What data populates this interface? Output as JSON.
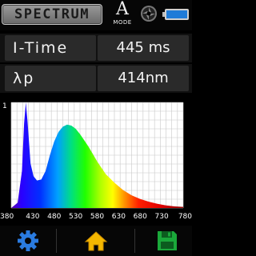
{
  "header": {
    "title": "SPECTRUM",
    "mode_letter": "A",
    "mode_label": "MODE",
    "icons": [
      "shutter-icon",
      "battery-icon"
    ]
  },
  "readings": {
    "itime_label": "I-Time",
    "itime_value": "445 ms",
    "peak_label": "λp",
    "peak_value": "414nm"
  },
  "chart_data": {
    "type": "area",
    "title": "",
    "xlabel": "",
    "ylabel": "",
    "y_tick_label": "1",
    "xlim": [
      380,
      780
    ],
    "ylim": [
      0,
      1
    ],
    "x_tick_labels": [
      "380",
      "430",
      "480",
      "530",
      "580",
      "630",
      "680",
      "730",
      "780"
    ],
    "grid": true,
    "fill": "visible-spectrum gradient",
    "series": [
      {
        "x": [
          380,
          395,
          405,
          410,
          414,
          418,
          425,
          432,
          440,
          450,
          460,
          470,
          480,
          490,
          500,
          510,
          520,
          530,
          540,
          550,
          560,
          570,
          580,
          590,
          600,
          620,
          640,
          660,
          680,
          700,
          720,
          740,
          760,
          780
        ],
        "values": [
          0.0,
          0.05,
          0.35,
          0.8,
          1.0,
          0.82,
          0.42,
          0.3,
          0.26,
          0.27,
          0.35,
          0.5,
          0.63,
          0.72,
          0.77,
          0.79,
          0.78,
          0.75,
          0.7,
          0.64,
          0.58,
          0.51,
          0.44,
          0.38,
          0.32,
          0.24,
          0.17,
          0.12,
          0.085,
          0.06,
          0.04,
          0.025,
          0.015,
          0.01
        ]
      }
    ]
  },
  "footer": {
    "buttons": [
      "gear-icon",
      "home-icon",
      "save-icon"
    ]
  }
}
